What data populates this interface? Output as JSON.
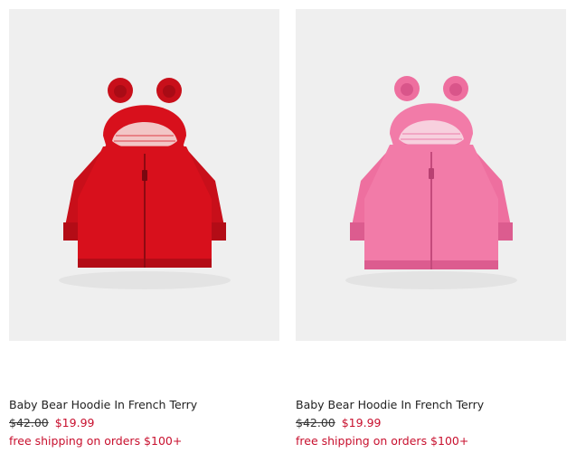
{
  "products": [
    {
      "name": "Baby Bear Hoodie In French Terry",
      "original_price": "$42.00",
      "sale_price": "$19.99",
      "shipping_note": "free shipping on orders $100+",
      "color": "#d8101c",
      "color_dark": "#b30c16",
      "lining": "#f2c6c6"
    },
    {
      "name": "Baby Bear Hoodie In French Terry",
      "original_price": "$42.00",
      "sale_price": "$19.99",
      "shipping_note": "free shipping on orders $100+",
      "color": "#f27ba8",
      "color_dark": "#dc5c8f",
      "lining": "#f7d0de"
    }
  ],
  "colors": {
    "sale": "#c8102e",
    "image_background": "#efefef"
  }
}
